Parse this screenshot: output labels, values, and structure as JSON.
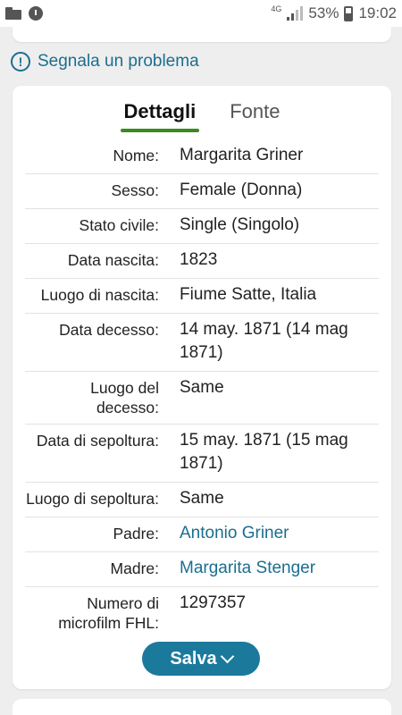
{
  "status_bar": {
    "network": "4G",
    "battery": "53%",
    "time": "19:02"
  },
  "report_problem": {
    "icon": "!",
    "label": "Segnala un problema"
  },
  "tabs": [
    {
      "label": "Dettagli",
      "active": true
    },
    {
      "label": "Fonte",
      "active": false
    }
  ],
  "details": [
    {
      "label": "Nome:",
      "value": "Margarita Griner",
      "link": false
    },
    {
      "label": "Sesso:",
      "value": "Female (Donna)",
      "link": false
    },
    {
      "label": "Stato civile:",
      "value": "Single (Singolo)",
      "link": false
    },
    {
      "label": "Data nascita:",
      "value": "1823",
      "link": false
    },
    {
      "label": "Luogo di nascita:",
      "value": "Fiume Satte, Italia",
      "link": false
    },
    {
      "label": "Data decesso:",
      "value": "14 may. 1871 (14 mag 1871)",
      "link": false
    },
    {
      "label": "Luogo del decesso:",
      "value": "Same",
      "link": false
    },
    {
      "label": "Data di sepoltura:",
      "value": "15 may. 1871 (15 mag 1871)",
      "link": false
    },
    {
      "label": "Luogo di sepoltura:",
      "value": "Same",
      "link": false
    },
    {
      "label": "Padre:",
      "value": "Antonio Griner",
      "link": true
    },
    {
      "label": "Madre:",
      "value": "Margarita Stenger",
      "link": true
    },
    {
      "label": "Numero di microfilm FHL:",
      "value": "1297357",
      "link": false
    }
  ],
  "save_button": {
    "label": "Salva"
  },
  "colors": {
    "accent": "#1b7a9c",
    "link": "#1b6e8f",
    "tab_underline": "#3b8a1e"
  }
}
